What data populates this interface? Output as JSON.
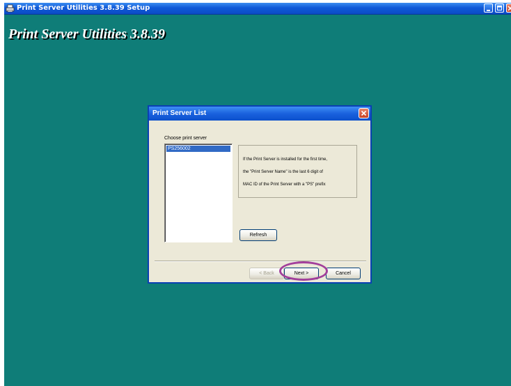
{
  "window": {
    "title": "Print Server Utilities 3.8.39 Setup",
    "banner_title": "Print Server Utilities 3.8.39",
    "background_color": "#0f7d78"
  },
  "dialog": {
    "title": "Print Server List",
    "choose_label": "Choose print server",
    "servers": [
      "PS256002"
    ],
    "selected_server": "PS256002",
    "info_lines": [
      "If the Print Server is installed for the first time,",
      "the \"Print Server Name\" is the last 6 digit of",
      "MAC ID of the Print Server with a \"PS\" prefix"
    ],
    "refresh_label": "Refresh",
    "back_label": "< Back",
    "next_label": "Next >",
    "cancel_label": "Cancel"
  },
  "annotation": {
    "highlight_color": "#a23f9b"
  }
}
